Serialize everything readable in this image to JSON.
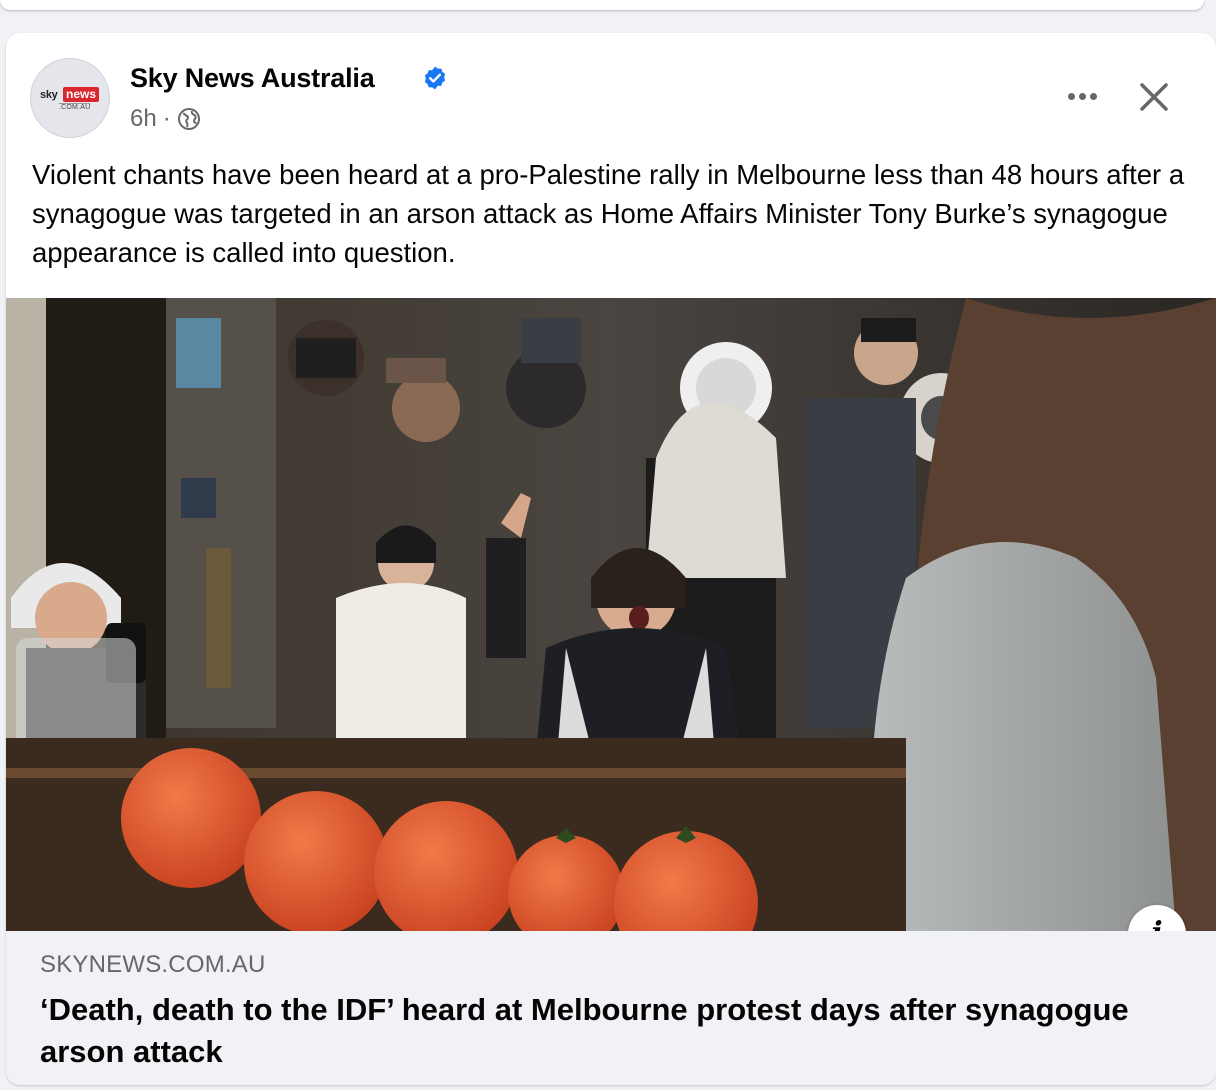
{
  "post": {
    "page_name": "Sky News Australia",
    "verified": true,
    "time": "6h",
    "separator": "·",
    "audience_icon": "globe-icon",
    "avatar_logo": {
      "sky": "sky",
      "news": "news",
      "domain": ".COM.AU"
    },
    "body_text": "Violent chants have been heard at a pro-Palestine rally in Melbourne less than 48 hours after a synagogue was targeted in an arson attack as Home Affairs Minister Tony Burke’s synagogue appearance is called into question.",
    "more_icon": "more-options-icon",
    "close_icon": "close-icon",
    "info_label": "i"
  },
  "link_preview": {
    "domain": "SKYNEWS.COM.AU",
    "title": "‘Death, death to the IDF’ heard at Melbourne protest days after synagogue arson attack"
  },
  "colors": {
    "background": "#f0f2f5",
    "card": "#ffffff",
    "text_primary": "#050505",
    "text_secondary": "#65676b",
    "verified_blue": "#1877f2",
    "sky_red": "#d9262f"
  }
}
